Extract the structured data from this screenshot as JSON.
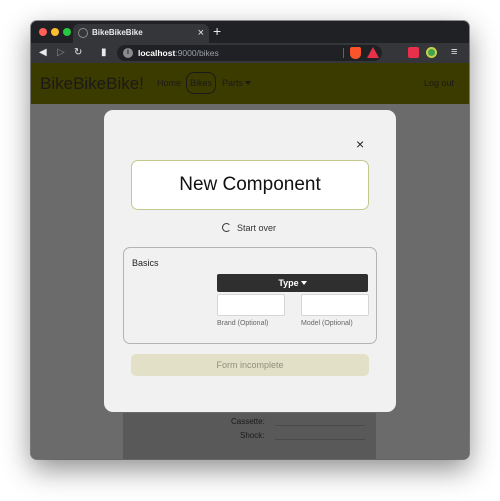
{
  "browser": {
    "tab_title": "BikeBikeBike",
    "tab_close": "×",
    "new_tab": "+",
    "url_host": "localhost",
    "url_rest": ":9000/bikes",
    "icons": [
      "back-icon",
      "forward-icon",
      "reload-icon",
      "bookmark-icon",
      "site-info-icon",
      "brave-shields-icon",
      "rewards-icon",
      "extension-icon",
      "extension-icon",
      "menu-icon"
    ]
  },
  "navbar": {
    "brand": "BikeBikeBike!",
    "links": [
      "Home",
      "Bikes",
      "Parts",
      "Log out"
    ]
  },
  "background": {
    "labels": [
      "Cassette:",
      "Shock:"
    ]
  },
  "modal": {
    "close": "×",
    "title": "New Component",
    "start_over": "Start over",
    "basics_label": "Basics",
    "type_button": "Type",
    "brand_label": "Brand (Optional)",
    "model_label": "Model (Optional)",
    "submit_label": "Form incomplete"
  },
  "colors": {
    "navbar_bg": "#3b3b00",
    "page_overlay": "#6b6b6b",
    "modal_bg": "#f1f1f1",
    "title_border": "#c5c88e",
    "submit_bg": "#e2e1c8"
  }
}
